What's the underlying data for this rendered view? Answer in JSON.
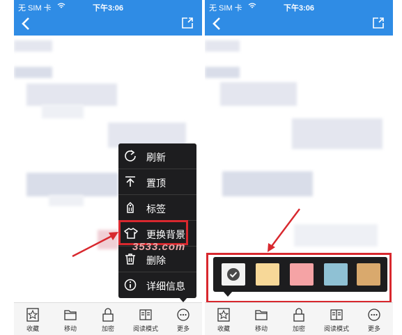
{
  "status_bar": {
    "carrier": "无 SIM 卡",
    "time": "下午3:06"
  },
  "toolbar": {
    "items": [
      {
        "label": "收藏",
        "icon": "star-icon"
      },
      {
        "label": "移动",
        "icon": "folder-icon"
      },
      {
        "label": "加密",
        "icon": "lock-icon"
      },
      {
        "label": "阅读模式",
        "icon": "book-icon"
      },
      {
        "label": "更多",
        "icon": "more-icon"
      }
    ]
  },
  "menu": {
    "items": [
      {
        "label": "刷新",
        "icon": "refresh-icon"
      },
      {
        "label": "置顶",
        "icon": "pin-top-icon"
      },
      {
        "label": "标签",
        "icon": "tag-icon"
      },
      {
        "label": "更换背景",
        "icon": "shirt-icon"
      },
      {
        "label": "删除",
        "icon": "trash-icon"
      },
      {
        "label": "详细信息",
        "icon": "info-icon"
      }
    ],
    "highlighted_item": "更换背景"
  },
  "background_options": {
    "selected_index": 0,
    "colors": [
      "#f2f2f2",
      "#f7d898",
      "#f5a3a5",
      "#8fc1d4",
      "#d9a96d"
    ]
  },
  "watermark": "3533.com",
  "accent_color": "#2f8ce5",
  "highlight_color": "#d8282e"
}
